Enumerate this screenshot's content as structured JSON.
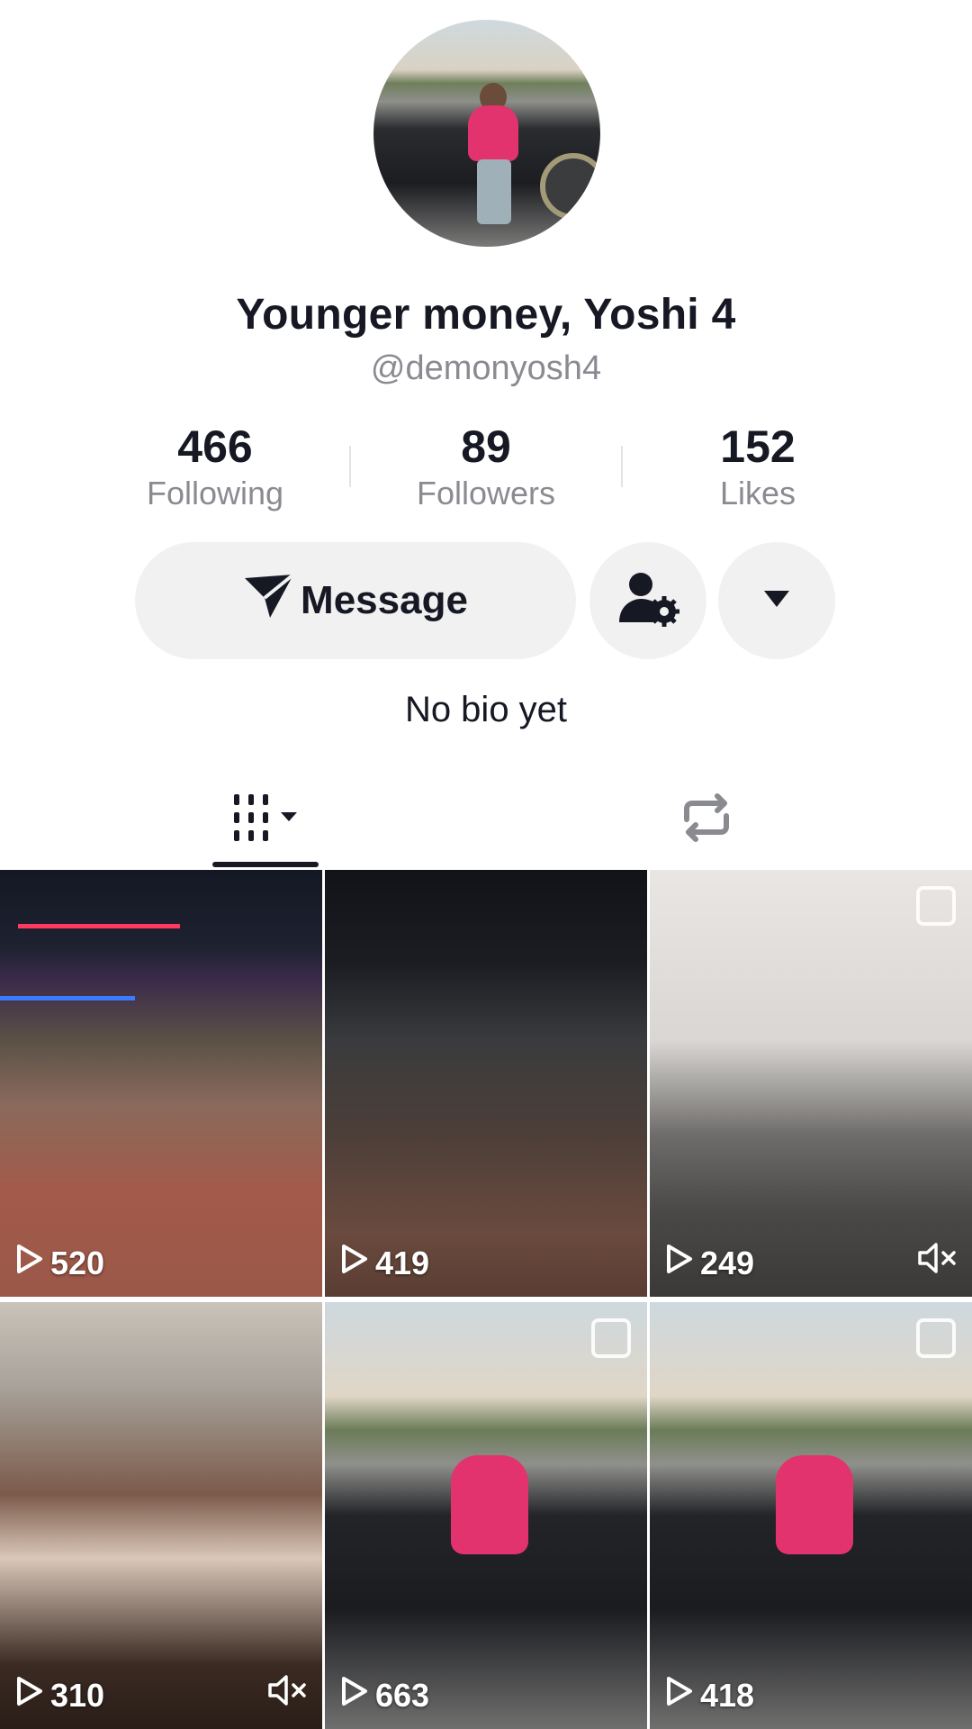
{
  "profile": {
    "display_name": "Younger money, Yoshi 4",
    "username": "@demonyosh4",
    "bio": "No bio yet"
  },
  "stats": [
    {
      "value": "466",
      "label": "Following"
    },
    {
      "value": "89",
      "label": "Followers"
    },
    {
      "value": "152",
      "label": "Likes"
    }
  ],
  "actions": {
    "message_label": "Message",
    "icons": [
      "send-icon",
      "user-settings-icon",
      "dropdown-caret-icon"
    ]
  },
  "tabs": [
    {
      "icon": "videos-grid-icon",
      "selected": true
    },
    {
      "icon": "repost-icon",
      "selected": false
    }
  ],
  "videos": [
    {
      "views": "520",
      "muted": false,
      "multi": false
    },
    {
      "views": "419",
      "muted": false,
      "multi": false
    },
    {
      "views": "249",
      "muted": true,
      "multi": true
    },
    {
      "views": "310",
      "muted": true,
      "multi": false
    },
    {
      "views": "663",
      "muted": false,
      "multi": true
    },
    {
      "views": "418",
      "muted": false,
      "multi": true
    }
  ]
}
